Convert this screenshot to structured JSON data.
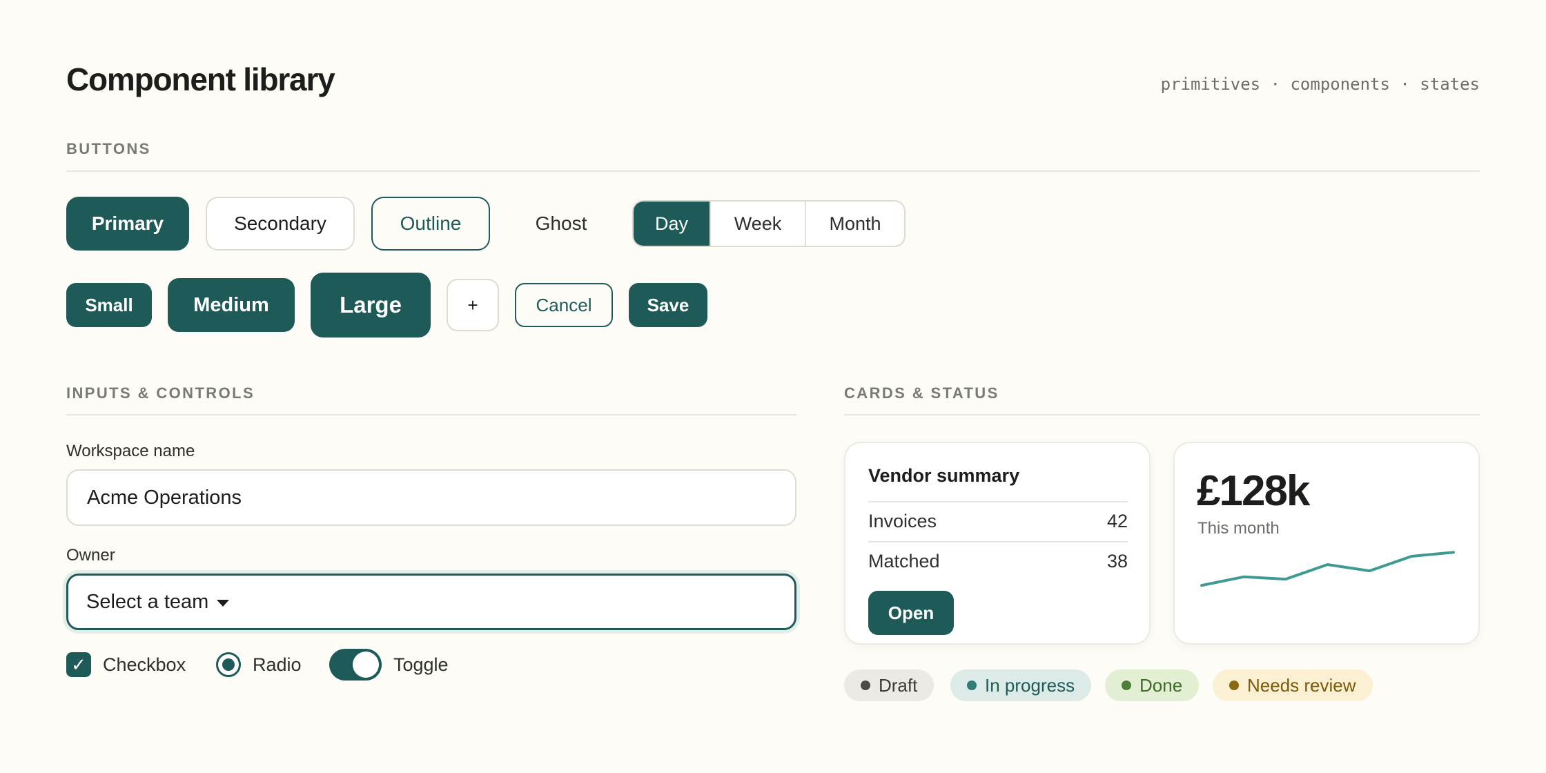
{
  "header": {
    "title": "Component library",
    "tags": "primitives · components · states"
  },
  "buttons_section": {
    "label": "BUTTONS",
    "variants": {
      "primary": "Primary",
      "secondary": "Secondary",
      "outline": "Outline",
      "ghost": "Ghost"
    },
    "segmented": {
      "options": [
        "Day",
        "Week",
        "Month"
      ],
      "selected": "Day"
    },
    "sizes": {
      "small": "Small",
      "medium": "Medium",
      "large": "Large"
    },
    "icon_button": "+",
    "cancel": "Cancel",
    "save": "Save"
  },
  "inputs_section": {
    "label": "INPUTS & CONTROLS",
    "workspace": {
      "label": "Workspace name",
      "value": "Acme Operations"
    },
    "owner": {
      "label": "Owner",
      "value": "Select a team"
    },
    "checkbox": {
      "label": "Checkbox",
      "checked": true
    },
    "radio": {
      "label": "Radio",
      "selected": true
    },
    "toggle": {
      "label": "Toggle",
      "on": true
    }
  },
  "cards_section": {
    "label": "CARDS & STATUS",
    "vendor_card": {
      "title": "Vendor summary",
      "rows": [
        {
          "label": "Invoices",
          "value": "42"
        },
        {
          "label": "Matched",
          "value": "38"
        }
      ],
      "action": "Open"
    },
    "metric_card": {
      "value": "£128k",
      "caption": "This month",
      "sparkline": [
        0.12,
        0.38,
        0.31,
        0.75,
        0.56,
        1.0,
        1.12
      ]
    },
    "badges": [
      {
        "label": "Draft",
        "dot": "#4a4a46",
        "bg": "#eceae4",
        "fg": "#3a3a36"
      },
      {
        "label": "In progress",
        "dot": "#2f7d76",
        "bg": "#dcebe7",
        "fg": "#1e5a58"
      },
      {
        "label": "Done",
        "dot": "#4f7d3a",
        "bg": "#e3efd2",
        "fg": "#3e6a2b"
      },
      {
        "label": "Needs review",
        "dot": "#8a6a10",
        "bg": "#fbf0d2",
        "fg": "#7a5a08"
      }
    ]
  },
  "colors": {
    "accent": "#1e5a58",
    "sparkline": "#3f9a94",
    "background": "#fdfcf6"
  }
}
